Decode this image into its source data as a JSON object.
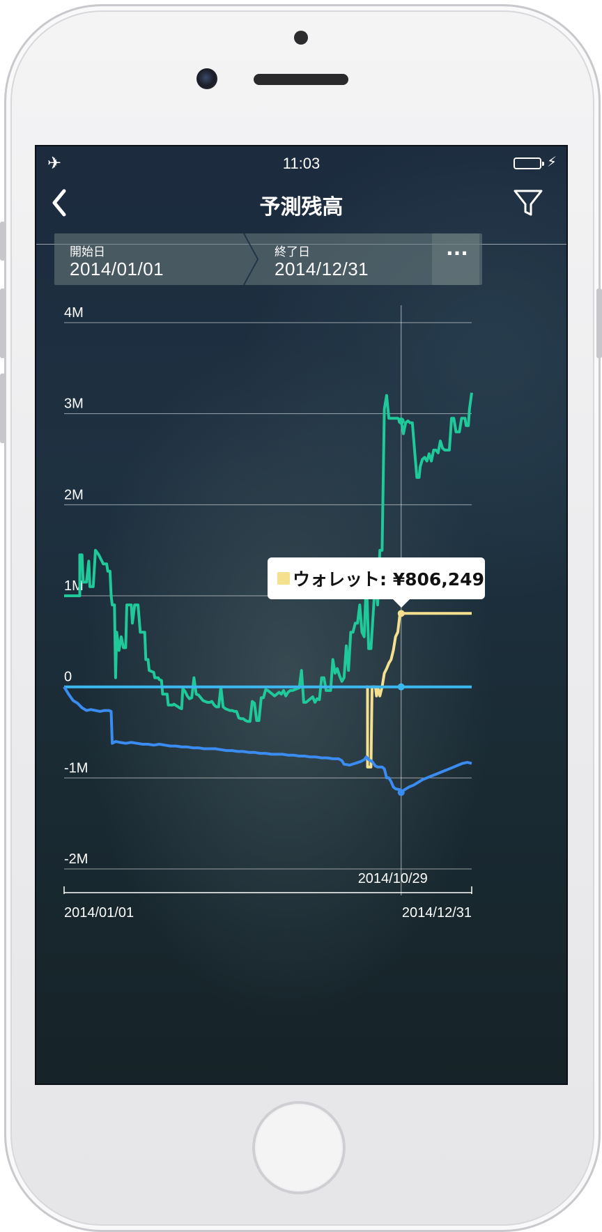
{
  "status_bar": {
    "time": "11:03"
  },
  "navbar": {
    "title": "予測残高"
  },
  "range": {
    "start_label": "開始日",
    "start_value": "2014/01/01",
    "end_label": "終了日",
    "end_value": "2014/12/31",
    "more_label": "···"
  },
  "tooltip": {
    "text": "ウォレット: ¥806,249",
    "color": "#f5e08f"
  },
  "colors": {
    "green": "#1fc99a",
    "yellow": "#f5e08f",
    "cyan": "#3cb8f0",
    "blue": "#3b8cf0"
  },
  "chart_data": {
    "type": "line",
    "ylim": [
      -2000000,
      4000000
    ],
    "y_ticks": [
      {
        "value": 4000000,
        "label": "4M"
      },
      {
        "value": 3000000,
        "label": "3M"
      },
      {
        "value": 2000000,
        "label": "2M"
      },
      {
        "value": 1000000,
        "label": "1M"
      },
      {
        "value": 0,
        "label": "0"
      },
      {
        "value": -1000000,
        "label": "-1M"
      },
      {
        "value": -2000000,
        "label": "-2M"
      }
    ],
    "x_start_label": "2014/01/01",
    "x_end_label": "2014/12/31",
    "cursor_label": "2014/10/29",
    "cursor_day": 301,
    "series": [
      {
        "color": "#1fc99a",
        "points": [
          [
            0,
            1000000
          ],
          [
            14,
            1000000
          ],
          [
            14,
            1450000
          ],
          [
            16,
            1450000
          ],
          [
            17,
            1150000
          ],
          [
            20,
            1150000
          ],
          [
            22,
            1380000
          ],
          [
            23,
            1100000
          ],
          [
            26,
            1100000
          ],
          [
            28,
            1500000
          ],
          [
            31,
            1450000
          ],
          [
            33,
            1400000
          ],
          [
            35,
            1350000
          ],
          [
            38,
            1350000
          ],
          [
            39,
            1270000
          ],
          [
            41,
            1270000
          ],
          [
            42,
            1000000
          ],
          [
            43,
            900000
          ],
          [
            45,
            900000
          ],
          [
            46,
            100000
          ],
          [
            47,
            600000
          ],
          [
            49,
            400000
          ],
          [
            51,
            550000
          ],
          [
            53,
            430000
          ],
          [
            55,
            430000
          ],
          [
            56,
            900000
          ],
          [
            60,
            900000
          ],
          [
            61,
            700000
          ],
          [
            63,
            900000
          ],
          [
            66,
            900000
          ],
          [
            68,
            600000
          ],
          [
            72,
            600000
          ],
          [
            73,
            300000
          ],
          [
            75,
            300000
          ],
          [
            76,
            180000
          ],
          [
            80,
            160000
          ],
          [
            81,
            100000
          ],
          [
            84,
            100000
          ],
          [
            85,
            80000
          ],
          [
            87,
            70000
          ],
          [
            88,
            -80000
          ],
          [
            92,
            -80000
          ],
          [
            93,
            -200000
          ],
          [
            97,
            -200000
          ],
          [
            98,
            -190000
          ],
          [
            102,
            -220000
          ],
          [
            103,
            -230000
          ],
          [
            105,
            -240000
          ],
          [
            106,
            -20000
          ],
          [
            108,
            -50000
          ],
          [
            110,
            -100000
          ],
          [
            112,
            -130000
          ],
          [
            114,
            -120000
          ],
          [
            116,
            100000
          ],
          [
            118,
            -80000
          ],
          [
            120,
            -90000
          ],
          [
            122,
            -120000
          ],
          [
            124,
            -150000
          ],
          [
            126,
            -160000
          ],
          [
            128,
            -170000
          ],
          [
            130,
            -170000
          ],
          [
            132,
            -160000
          ],
          [
            134,
            -200000
          ],
          [
            136,
            -220000
          ],
          [
            138,
            -220000
          ],
          [
            140,
            0
          ],
          [
            142,
            -220000
          ],
          [
            144,
            -240000
          ],
          [
            146,
            -250000
          ],
          [
            148,
            -260000
          ],
          [
            150,
            -260000
          ],
          [
            152,
            -270000
          ],
          [
            154,
            -270000
          ],
          [
            156,
            -340000
          ],
          [
            158,
            -350000
          ],
          [
            160,
            -350000
          ],
          [
            162,
            -370000
          ],
          [
            164,
            -380000
          ],
          [
            166,
            -380000
          ],
          [
            168,
            -160000
          ],
          [
            170,
            -180000
          ],
          [
            172,
            -370000
          ],
          [
            174,
            -370000
          ],
          [
            176,
            -120000
          ],
          [
            178,
            -120000
          ],
          [
            180,
            -30000
          ],
          [
            182,
            -40000
          ],
          [
            184,
            -60000
          ],
          [
            186,
            -80000
          ],
          [
            188,
            -100000
          ],
          [
            190,
            -80000
          ],
          [
            192,
            -60000
          ],
          [
            194,
            -80000
          ],
          [
            196,
            -40000
          ],
          [
            198,
            -100000
          ],
          [
            200,
            -60000
          ],
          [
            202,
            -40000
          ],
          [
            204,
            -40000
          ],
          [
            206,
            -30000
          ],
          [
            208,
            -20000
          ],
          [
            210,
            -10000
          ],
          [
            212,
            180000
          ],
          [
            214,
            -170000
          ],
          [
            216,
            -170000
          ],
          [
            218,
            -150000
          ],
          [
            220,
            -130000
          ],
          [
            222,
            -110000
          ],
          [
            224,
            -170000
          ],
          [
            226,
            -130000
          ],
          [
            228,
            -140000
          ],
          [
            230,
            100000
          ],
          [
            232,
            100000
          ],
          [
            234,
            -40000
          ],
          [
            236,
            -40000
          ],
          [
            238,
            -40000
          ],
          [
            240,
            300000
          ],
          [
            242,
            150000
          ],
          [
            244,
            200000
          ],
          [
            246,
            120000
          ],
          [
            248,
            60000
          ],
          [
            250,
            100000
          ],
          [
            252,
            450000
          ],
          [
            254,
            180000
          ],
          [
            256,
            600000
          ],
          [
            258,
            600000
          ],
          [
            260,
            700000
          ],
          [
            262,
            700000
          ],
          [
            264,
            900000
          ],
          [
            266,
            600000
          ],
          [
            268,
            550000
          ],
          [
            270,
            1200000
          ],
          [
            272,
            420000
          ],
          [
            274,
            420000
          ],
          [
            276,
            800000
          ],
          [
            278,
            1200000
          ],
          [
            280,
            900000
          ],
          [
            282,
            1500000
          ],
          [
            284,
            1500000
          ],
          [
            286,
            3050000
          ],
          [
            288,
            3200000
          ],
          [
            290,
            2950000
          ],
          [
            292,
            2950000
          ],
          [
            294,
            2950000
          ],
          [
            296,
            2950000
          ],
          [
            298,
            2950000
          ],
          [
            300,
            2920000
          ],
          [
            301,
            2920000
          ],
          [
            303,
            2780000
          ],
          [
            305,
            2900000
          ],
          [
            307,
            2920000
          ],
          [
            309,
            2900000
          ],
          [
            311,
            2900000
          ],
          [
            313,
            2600000
          ],
          [
            315,
            2300000
          ],
          [
            317,
            2300000
          ],
          [
            318,
            2420000
          ],
          [
            320,
            2500000
          ],
          [
            322,
            2520000
          ],
          [
            324,
            2480000
          ],
          [
            326,
            2560000
          ],
          [
            328,
            2480000
          ],
          [
            330,
            2600000
          ],
          [
            332,
            2600000
          ],
          [
            334,
            2570000
          ],
          [
            336,
            2700000
          ],
          [
            338,
            2620000
          ],
          [
            340,
            2600000
          ],
          [
            342,
            2600000
          ],
          [
            344,
            2600000
          ],
          [
            346,
            2950000
          ],
          [
            348,
            2950000
          ],
          [
            350,
            2800000
          ],
          [
            353,
            2800000
          ],
          [
            355,
            2950000
          ],
          [
            358,
            2950000
          ],
          [
            359,
            2870000
          ],
          [
            361,
            2870000
          ],
          [
            362,
            3050000
          ],
          [
            364,
            3230000
          ]
        ]
      },
      {
        "color": "#f5e08f",
        "points": [
          [
            270,
            0
          ],
          [
            271,
            0
          ],
          [
            271,
            -880000
          ],
          [
            274,
            -880000
          ],
          [
            275,
            0
          ],
          [
            278,
            0
          ],
          [
            279,
            -100000
          ],
          [
            280,
            0
          ],
          [
            282,
            -100000
          ],
          [
            284,
            0
          ],
          [
            286,
            150000
          ],
          [
            288,
            200000
          ],
          [
            290,
            260000
          ],
          [
            292,
            300000
          ],
          [
            294,
            400000
          ],
          [
            296,
            550000
          ],
          [
            298,
            600000
          ],
          [
            300,
            806249
          ],
          [
            364,
            806249
          ]
        ]
      },
      {
        "color": "#3cb8f0",
        "points": [
          [
            0,
            0
          ],
          [
            364,
            0
          ]
        ]
      },
      {
        "color": "#3b8cf0",
        "points": [
          [
            0,
            0
          ],
          [
            4,
            -80000
          ],
          [
            8,
            -150000
          ],
          [
            12,
            -180000
          ],
          [
            16,
            -230000
          ],
          [
            20,
            -260000
          ],
          [
            24,
            -250000
          ],
          [
            28,
            -260000
          ],
          [
            32,
            -270000
          ],
          [
            36,
            -260000
          ],
          [
            40,
            -260000
          ],
          [
            42,
            -270000
          ],
          [
            43,
            -620000
          ],
          [
            46,
            -600000
          ],
          [
            50,
            -610000
          ],
          [
            55,
            -620000
          ],
          [
            60,
            -610000
          ],
          [
            65,
            -620000
          ],
          [
            70,
            -630000
          ],
          [
            75,
            -630000
          ],
          [
            80,
            -640000
          ],
          [
            85,
            -630000
          ],
          [
            90,
            -640000
          ],
          [
            95,
            -650000
          ],
          [
            100,
            -650000
          ],
          [
            105,
            -660000
          ],
          [
            110,
            -660000
          ],
          [
            115,
            -670000
          ],
          [
            120,
            -670000
          ],
          [
            125,
            -680000
          ],
          [
            130,
            -680000
          ],
          [
            135,
            -680000
          ],
          [
            140,
            -690000
          ],
          [
            145,
            -700000
          ],
          [
            150,
            -700000
          ],
          [
            155,
            -710000
          ],
          [
            160,
            -710000
          ],
          [
            165,
            -720000
          ],
          [
            170,
            -720000
          ],
          [
            175,
            -730000
          ],
          [
            180,
            -730000
          ],
          [
            185,
            -740000
          ],
          [
            190,
            -740000
          ],
          [
            195,
            -740000
          ],
          [
            200,
            -750000
          ],
          [
            205,
            -750000
          ],
          [
            210,
            -760000
          ],
          [
            215,
            -760000
          ],
          [
            220,
            -770000
          ],
          [
            225,
            -770000
          ],
          [
            230,
            -780000
          ],
          [
            235,
            -780000
          ],
          [
            240,
            -790000
          ],
          [
            245,
            -790000
          ],
          [
            248,
            -810000
          ],
          [
            250,
            -850000
          ],
          [
            255,
            -860000
          ],
          [
            260,
            -840000
          ],
          [
            265,
            -820000
          ],
          [
            268,
            -800000
          ],
          [
            270,
            -770000
          ],
          [
            272,
            -800000
          ],
          [
            275,
            -820000
          ],
          [
            278,
            -870000
          ],
          [
            280,
            -880000
          ],
          [
            284,
            -880000
          ],
          [
            286,
            -900000
          ],
          [
            288,
            -1000000
          ],
          [
            290,
            -1000000
          ],
          [
            292,
            -1040000
          ],
          [
            294,
            -1100000
          ],
          [
            296,
            -1120000
          ],
          [
            300,
            -1130000
          ],
          [
            301,
            -1160000
          ],
          [
            304,
            -1130000
          ],
          [
            308,
            -1100000
          ],
          [
            312,
            -1080000
          ],
          [
            316,
            -1050000
          ],
          [
            320,
            -1020000
          ],
          [
            324,
            -1000000
          ],
          [
            328,
            -980000
          ],
          [
            332,
            -960000
          ],
          [
            336,
            -940000
          ],
          [
            340,
            -920000
          ],
          [
            344,
            -900000
          ],
          [
            348,
            -880000
          ],
          [
            352,
            -860000
          ],
          [
            356,
            -840000
          ],
          [
            360,
            -830000
          ],
          [
            364,
            -840000
          ]
        ]
      }
    ]
  }
}
